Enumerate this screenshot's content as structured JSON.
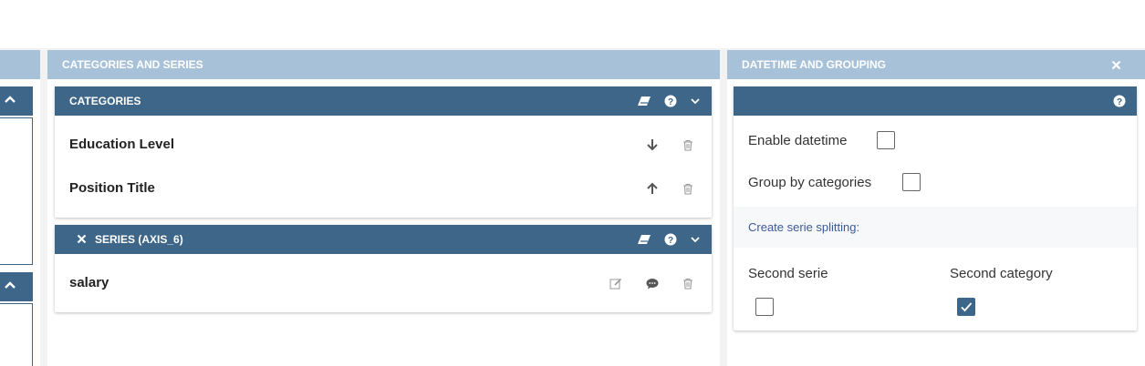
{
  "categories_panel": {
    "title": "CATEGORIES AND SERIES",
    "categories_card": {
      "title": "CATEGORIES",
      "items": [
        {
          "label": "Education Level",
          "move": "arrow-down-icon"
        },
        {
          "label": "Position Title",
          "move": "arrow-up-icon"
        }
      ]
    },
    "series_card": {
      "title": "SERIES (AXIS_6)",
      "items": [
        {
          "label": "salary"
        }
      ]
    }
  },
  "datetime_panel": {
    "title": "DATETIME AND GROUPING",
    "enable_datetime_label": "Enable datetime",
    "enable_datetime_checked": false,
    "group_by_label": "Group by categories",
    "group_by_checked": false,
    "split_label": "Create serie splitting:",
    "second_serie_label": "Second serie",
    "second_serie_checked": false,
    "second_category_label": "Second category",
    "second_category_checked": true
  },
  "colors": {
    "header_light": "#a7c1d9",
    "header_dark": "#3d6689",
    "link": "#3b5a9a"
  }
}
